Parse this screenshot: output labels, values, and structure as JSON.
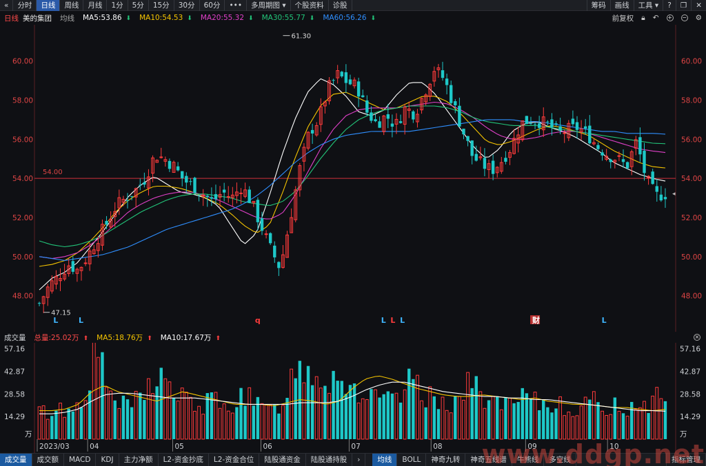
{
  "toolbar": {
    "back_icon": "chevron-left-icon",
    "tabs": [
      "分时",
      "日线",
      "周线",
      "月线",
      "1分",
      "5分",
      "15分",
      "30分",
      "60分"
    ],
    "active_tab": "日线",
    "more_icon": "ellipsis-icon",
    "multi_period": "多周期图",
    "profile": "个股资料",
    "diagnose": "诊股",
    "right_items": [
      "筹码",
      "画线",
      "工具"
    ],
    "right_icons": [
      "question-icon",
      "restore-icon",
      "close-icon"
    ]
  },
  "info": {
    "period": "日线",
    "stock_name": "美的集团",
    "ma_label": "均线",
    "ma": [
      {
        "label": "MA5:53.86",
        "color": "#ffffff",
        "dir": "down"
      },
      {
        "label": "MA10:54.53",
        "color": "#f5c400",
        "dir": "down"
      },
      {
        "label": "MA20:55.32",
        "color": "#e040c8",
        "dir": "down"
      },
      {
        "label": "MA30:55.77",
        "color": "#22c57a",
        "dir": "down"
      },
      {
        "label": "MA60:56.26",
        "color": "#2f8fff",
        "dir": "down"
      }
    ],
    "adjust": "前复权",
    "right_icons": [
      "lock-icon",
      "undo-icon",
      "zoom-in-icon",
      "zoom-out-icon",
      "settings-icon"
    ]
  },
  "volume_header": {
    "label": "成交量",
    "total": "总量:25.02万",
    "ma5": "MA5:18.76万",
    "ma10": "MA10:17.67万",
    "close_icon": "close-icon"
  },
  "bottom_tabs": [
    "成交量",
    "成交额",
    "MACD",
    "KDJ",
    "主力净额",
    "L2-资金抄底",
    "L2-资金合位",
    "陆股通资金",
    "陆股通持股"
  ],
  "bottom_tabs_right": [
    "均线",
    "BOLL",
    "神奇九转",
    "神奇五线谱",
    "牛熊线",
    "多空线"
  ],
  "bottom_active_left": "成交量",
  "bottom_active_right": "均线",
  "bottom_more_icon": "chevron-right-icon",
  "bottom_settings": "指标管理",
  "watermark": "www.ddgp.net",
  "colors": {
    "up": "#ff3b3b",
    "down": "#1ec8c8",
    "ma5": "#ffffff",
    "ma10": "#f5c400",
    "ma20": "#e040c8",
    "ma30": "#22c57a",
    "ma60": "#2f8fff",
    "ref_line": "#d0303a"
  },
  "chart_data": [
    {
      "type": "candlestick",
      "title": "美的集团 日线",
      "ylim": [
        47,
        61.5
      ],
      "y_ticks": [
        "60.00",
        "58.00",
        "56.00",
        "54.00",
        "52.00",
        "50.00",
        "48.00"
      ],
      "x_month_labels": [
        "2023/03",
        "04",
        "05",
        "06",
        "07",
        "08",
        "09",
        "10"
      ],
      "reference_line": {
        "value": 54.0,
        "label": "54.00"
      },
      "high_annotation": "61.30",
      "low_annotation": "47.15",
      "markers": [
        {
          "text": "L",
          "color": "#3fb6ff"
        },
        {
          "text": "L",
          "color": "#3fb6ff"
        },
        {
          "text": "q",
          "color": "#ff3b3b"
        },
        {
          "text": "L",
          "color": "#3fb6ff"
        },
        {
          "text": "L",
          "color": "#ff3b3b"
        },
        {
          "text": "L",
          "color": "#3fb6ff"
        },
        {
          "text": "财",
          "color": "#ffffff",
          "bg": "#b83030"
        },
        {
          "text": "L",
          "color": "#3fb6ff"
        }
      ],
      "close_anchors": [
        47.6,
        48.5,
        49.0,
        49.6,
        49.3,
        50.0,
        50.9,
        51.7,
        52.6,
        53.0,
        53.4,
        54.0,
        55.2,
        55.0,
        54.6,
        53.9,
        53.6,
        53.2,
        52.8,
        53.3,
        53.0,
        53.6,
        52.8,
        51.6,
        50.4,
        49.4,
        51.8,
        54.4,
        56.3,
        57.0,
        58.6,
        59.3,
        58.9,
        58.7,
        57.4,
        56.8,
        57.2,
        56.7,
        57.6,
        57.3,
        58.4,
        59.6,
        59.1,
        57.8,
        56.4,
        55.1,
        54.7,
        54.4,
        54.9,
        55.6,
        56.8,
        57.0,
        56.9,
        56.7,
        56.3,
        56.5,
        56.6,
        56.2,
        55.6,
        55.2,
        55.0,
        54.6,
        55.9,
        54.0,
        53.1,
        53.2
      ],
      "series": [
        {
          "name": "MA5",
          "anchors": [
            48.3,
            48.9,
            49.2,
            49.7,
            50.5,
            51.3,
            52.2,
            53.1,
            53.7,
            54.1,
            53.7,
            53.3,
            53.2,
            53.0,
            52.6,
            51.6,
            50.6,
            51.2,
            53.1,
            55.2,
            57.0,
            58.4,
            59.1,
            58.8,
            58.2,
            57.4,
            57.2,
            57.5,
            58.3,
            58.9,
            58.9,
            58.3,
            57.4,
            56.5,
            55.6,
            55.0,
            55.5,
            56.4,
            56.8,
            56.9,
            56.6,
            56.4,
            56.1,
            55.7,
            55.3,
            54.8,
            54.5,
            54.2,
            54.0,
            53.86
          ]
        },
        {
          "name": "MA10",
          "anchors": [
            49.5,
            49.6,
            49.8,
            50.2,
            50.8,
            51.5,
            52.3,
            52.9,
            53.3,
            53.6,
            53.6,
            53.5,
            53.3,
            53.0,
            52.7,
            52.2,
            51.6,
            51.2,
            51.6,
            53.2,
            55.0,
            56.6,
            57.7,
            58.3,
            58.4,
            58.1,
            57.8,
            57.5,
            57.6,
            57.9,
            58.2,
            58.2,
            57.9,
            57.3,
            56.6,
            55.9,
            55.7,
            55.9,
            56.2,
            56.5,
            56.7,
            56.6,
            56.4,
            56.2,
            55.8,
            55.4,
            55.1,
            54.8,
            54.6,
            54.53
          ]
        },
        {
          "name": "MA20",
          "anchors": [
            50.0,
            49.9,
            50.0,
            50.2,
            50.6,
            51.1,
            51.7,
            52.3,
            52.7,
            53.0,
            53.2,
            53.3,
            53.3,
            53.1,
            52.9,
            52.6,
            52.3,
            52.0,
            51.9,
            52.2,
            53.1,
            54.3,
            55.5,
            56.5,
            57.2,
            57.5,
            57.6,
            57.6,
            57.6,
            57.7,
            57.8,
            57.9,
            57.8,
            57.5,
            57.1,
            56.6,
            56.2,
            56.0,
            56.0,
            56.1,
            56.3,
            56.4,
            56.4,
            56.3,
            56.1,
            55.9,
            55.7,
            55.5,
            55.4,
            55.32
          ]
        },
        {
          "name": "MA30",
          "anchors": [
            50.8,
            50.6,
            50.5,
            50.6,
            50.8,
            51.1,
            51.5,
            51.9,
            52.3,
            52.6,
            52.9,
            53.1,
            53.2,
            53.2,
            53.1,
            53.0,
            52.8,
            52.7,
            52.6,
            52.8,
            53.3,
            54.1,
            55.0,
            55.8,
            56.5,
            57.0,
            57.3,
            57.5,
            57.6,
            57.7,
            57.7,
            57.7,
            57.6,
            57.4,
            57.1,
            56.9,
            56.8,
            56.7,
            56.7,
            56.7,
            56.6,
            56.5,
            56.4,
            56.3,
            56.2,
            56.1,
            56.0,
            55.9,
            55.8,
            55.77
          ]
        },
        {
          "name": "MA60",
          "anchors": [
            50.0,
            49.9,
            49.8,
            49.9,
            50.0,
            50.1,
            50.3,
            50.5,
            50.8,
            51.1,
            51.4,
            51.6,
            51.8,
            52.0,
            52.2,
            52.4,
            52.7,
            53.1,
            53.6,
            54.2,
            54.8,
            55.3,
            55.7,
            56.0,
            56.2,
            56.3,
            56.4,
            56.4,
            56.4,
            56.4,
            56.5,
            56.6,
            56.7,
            56.8,
            56.9,
            57.0,
            57.0,
            57.0,
            56.9,
            56.9,
            56.8,
            56.7,
            56.6,
            56.5,
            56.4,
            56.4,
            56.3,
            56.3,
            56.3,
            56.26
          ]
        }
      ]
    },
    {
      "type": "bar",
      "title": "成交量",
      "unit": "万",
      "ylim": [
        0,
        60
      ],
      "y_ticks": [
        "57.16",
        "42.87",
        "28.58",
        "14.29",
        "万"
      ],
      "x_month_labels": [
        "2023/03",
        "04",
        "05",
        "06",
        "07",
        "08",
        "09",
        "10"
      ],
      "volume_anchors": [
        18,
        16,
        20,
        17,
        22,
        35,
        58,
        32,
        25,
        20,
        24,
        30,
        40,
        38,
        28,
        26,
        22,
        20,
        27,
        18,
        22,
        30,
        24,
        20,
        18,
        22,
        36,
        48,
        45,
        40,
        38,
        42,
        35,
        30,
        28,
        24,
        26,
        22,
        32,
        38,
        28,
        24,
        26,
        22,
        30,
        35,
        28,
        24,
        22,
        20,
        26,
        24,
        22,
        20,
        24,
        18,
        20,
        22,
        24,
        19,
        22,
        18,
        25,
        20,
        28,
        24
      ],
      "series": [
        {
          "name": "MA5",
          "anchors": [
            18,
            18,
            19,
            22,
            30,
            34,
            30,
            28,
            26,
            24,
            27,
            30,
            28,
            26,
            24,
            22,
            22,
            22,
            21,
            23,
            25,
            24,
            22,
            24,
            32,
            38,
            40,
            38,
            35,
            32,
            30,
            28,
            27,
            27,
            28,
            27,
            26,
            25,
            26,
            24,
            23,
            22,
            22,
            21,
            20,
            20,
            19,
            18,
            18.76
          ]
        },
        {
          "name": "MA10",
          "anchors": [
            16,
            16,
            17,
            19,
            24,
            28,
            29,
            29,
            28,
            27,
            26,
            26,
            26,
            25,
            24,
            23,
            22,
            22,
            22,
            22,
            23,
            23,
            23,
            24,
            27,
            31,
            34,
            36,
            36,
            34,
            32,
            30,
            29,
            28,
            27,
            27,
            26,
            26,
            25,
            25,
            24,
            23,
            22,
            21,
            20,
            19,
            18,
            18,
            17.67
          ]
        }
      ]
    }
  ]
}
